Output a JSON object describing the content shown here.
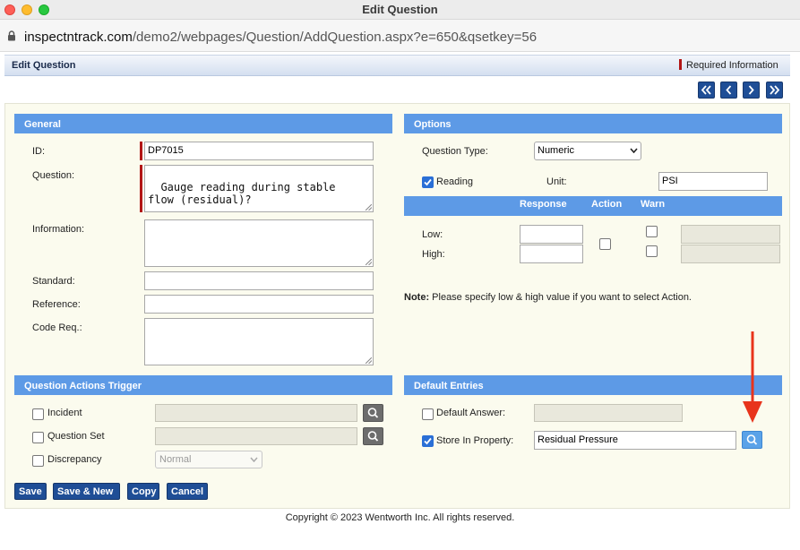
{
  "window": {
    "title": "Edit Question"
  },
  "browser": {
    "url_host": "inspectntrack.com",
    "url_path": "/demo2/webpages/Question/AddQuestion.aspx?e=650&qsetkey=56"
  },
  "page": {
    "title": "Edit Question",
    "required_info": "Required Information"
  },
  "general": {
    "header": "General",
    "id_label": "ID:",
    "id_value": "DP7015",
    "question_label": "Question:",
    "question_value": "Gauge reading during stable\nflow (residual)?",
    "information_label": "Information:",
    "information_value": "",
    "standard_label": "Standard:",
    "standard_value": "",
    "reference_label": "Reference:",
    "reference_value": "",
    "code_label": "Code Req.:",
    "code_value": ""
  },
  "options": {
    "header": "Options",
    "type_label": "Question Type:",
    "type_value": "Numeric",
    "reading_label": "Reading",
    "reading_checked": true,
    "unit_label": "Unit:",
    "unit_value": "PSI",
    "columns": [
      "Response",
      "Action",
      "Warn"
    ],
    "low_label": "Low:",
    "high_label": "High:",
    "note_bold": "Note:",
    "note_text": " Please specify low & high value if you want to select Action."
  },
  "triggers": {
    "header": "Question Actions Trigger",
    "incident_label": "Incident",
    "question_set_label": "Question Set",
    "discrepancy_label": "Discrepancy",
    "discrepancy_select": "Normal"
  },
  "defaults": {
    "header": "Default Entries",
    "default_answer_label": "Default Answer:",
    "default_answer_checked": false,
    "store_label": "Store In Property:",
    "store_checked": true,
    "store_value": "Residual Pressure"
  },
  "buttons": {
    "save": "Save",
    "save_new": "Save & New",
    "copy": "Copy",
    "cancel": "Cancel"
  },
  "footer": "Copyright © 2023 Wentworth Inc. All rights reserved.",
  "colors": {
    "section_header": "#5d9ae6",
    "nav_button": "#1f4e96",
    "required_marker": "#b21515",
    "annotation_arrow": "#e8341c"
  }
}
